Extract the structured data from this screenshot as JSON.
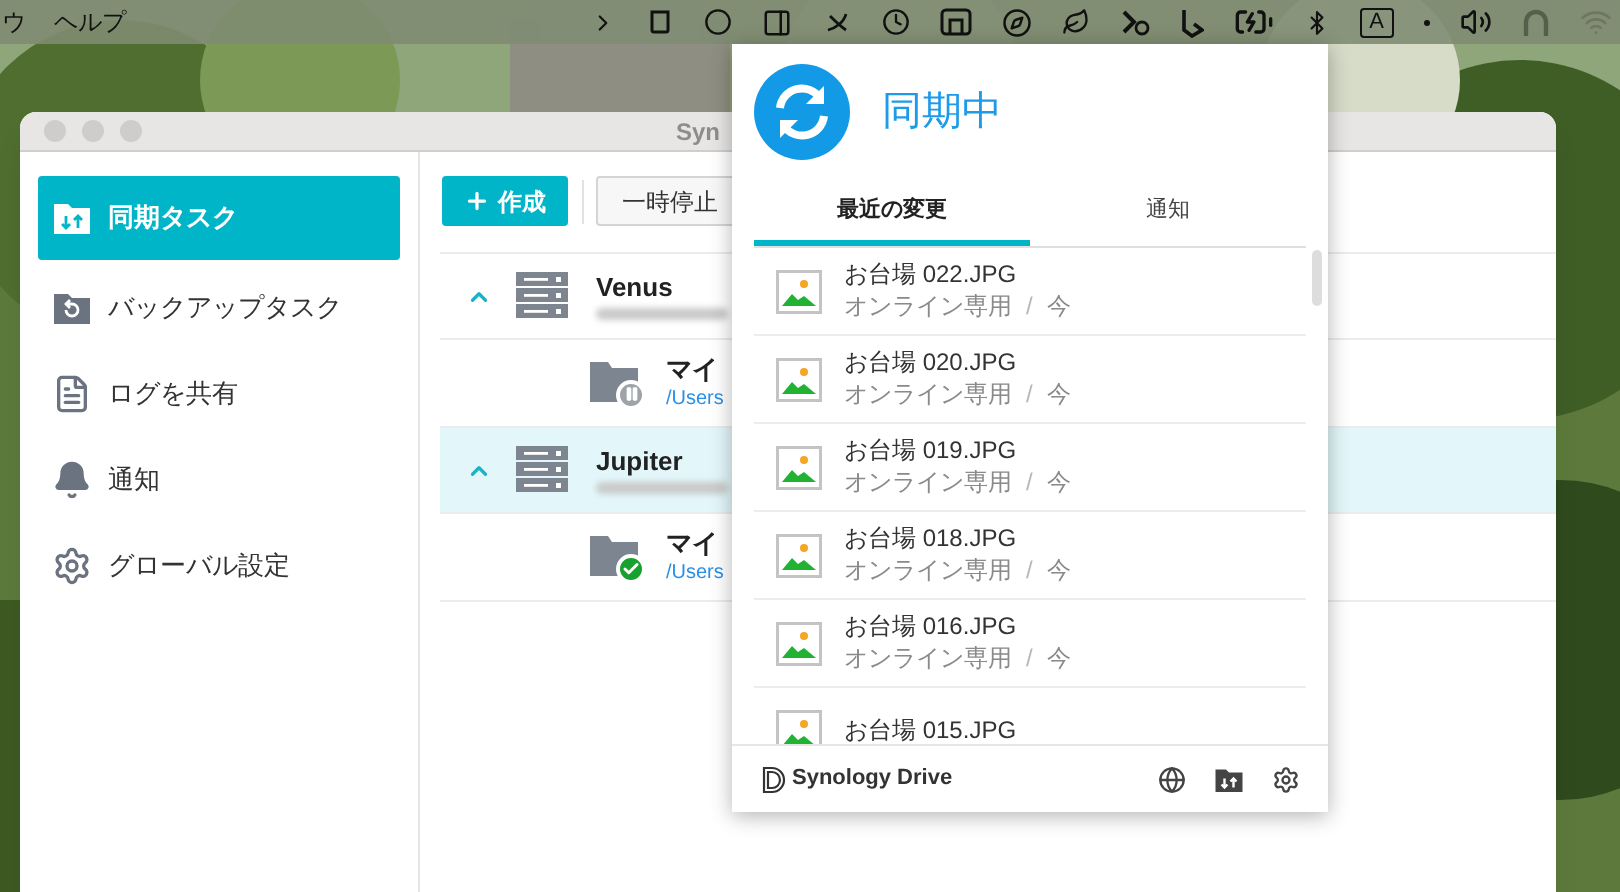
{
  "menu_bar": {
    "items": [
      "ウ",
      "ヘルプ"
    ],
    "input_source": "A"
  },
  "window": {
    "title": "Syn",
    "sidebar": {
      "items": [
        {
          "label": "同期タスク",
          "selected": true
        },
        {
          "label": "バックアップタスク",
          "selected": false
        },
        {
          "label": "ログを共有",
          "selected": false
        },
        {
          "label": "通知",
          "selected": false
        },
        {
          "label": "グローバル設定",
          "selected": false
        }
      ]
    },
    "toolbar": {
      "buttons": [
        {
          "label": "作成",
          "kind": "primary"
        },
        {
          "label": "一時停止",
          "kind": "secondary"
        }
      ]
    },
    "tasks": [
      {
        "server": "Venus",
        "selected": false,
        "expanded": true,
        "folders": [
          {
            "name": "マイ",
            "path": "/Users",
            "kind": "paused"
          }
        ]
      },
      {
        "server": "Jupiter",
        "selected": true,
        "expanded": true,
        "folders": [
          {
            "name": "マイ",
            "path": "/Users",
            "kind": "synced"
          }
        ]
      }
    ]
  },
  "popup": {
    "status": "同期中",
    "tabs": [
      {
        "label": "最近の変更",
        "selected": true
      },
      {
        "label": "通知",
        "selected": false
      }
    ],
    "changes": [
      {
        "name": "お台場 022.JPG",
        "location": "オンライン専用",
        "separator": "/",
        "time": "今"
      },
      {
        "name": "お台場 020.JPG",
        "location": "オンライン専用",
        "separator": "/",
        "time": "今"
      },
      {
        "name": "お台場 019.JPG",
        "location": "オンライン専用",
        "separator": "/",
        "time": "今"
      },
      {
        "name": "お台場 018.JPG",
        "location": "オンライン専用",
        "separator": "/",
        "time": "今"
      },
      {
        "name": "お台場 016.JPG",
        "location": "オンライン専用",
        "separator": "/",
        "time": "今"
      },
      {
        "name": "お台場 015.JPG"
      }
    ],
    "footer": {
      "brand": "Synology Drive"
    }
  }
}
